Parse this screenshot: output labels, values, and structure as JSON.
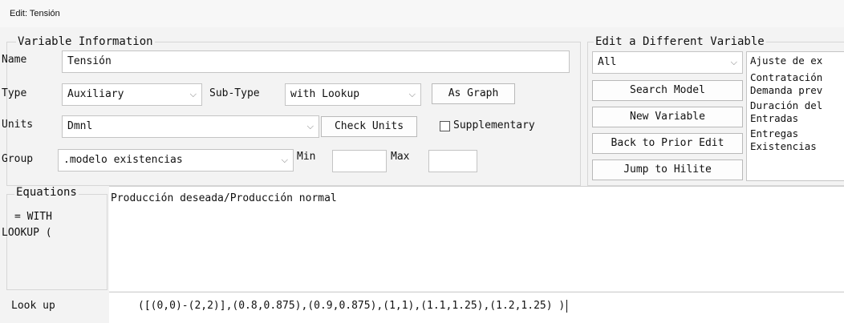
{
  "window": {
    "title": "Edit: Tensión"
  },
  "variable_info": {
    "legend": "Variable Information",
    "name_label": "Name",
    "name_value": "Tensión",
    "type_label": "Type",
    "type_value": "Auxiliary",
    "subtype_label": "Sub-Type",
    "subtype_value": "with Lookup",
    "as_graph_label": "As Graph",
    "units_label": "Units",
    "units_value": "Dmnl",
    "check_units_label": "Check Units",
    "supplementary_label": "Supplementary",
    "supplementary_checked": false,
    "group_label": "Group",
    "group_value": ".modelo existencias",
    "min_label": "Min",
    "min_value": "",
    "max_label": "Max",
    "max_value": ""
  },
  "edit_different": {
    "legend": "Edit a Different Variable",
    "filter_value": "All",
    "buttons": [
      "Search Model",
      "New Variable",
      "Back to Prior Edit",
      "Jump to Hilite"
    ],
    "variables": [
      "Ajuste de ex",
      "Contratación",
      "Demanda prev",
      "Duración del",
      "Entradas",
      "Entregas",
      "Existencias"
    ]
  },
  "equations": {
    "legend": "Equations",
    "prefix_line1": "= WITH",
    "prefix_line2": "LOOKUP (",
    "text": "Producción deseada/Producción normal"
  },
  "lookup": {
    "label": "Look up",
    "text": "([(0,0)-(2,2)],(0.8,0.875),(0.9,0.875),(1,1),(1.1,1.25),(1.2,1.25) )"
  },
  "colors": {
    "background": "#f3f3f3",
    "field": "#ffffff",
    "border": "#c4c4c4"
  },
  "icons": {
    "dropdown": "chevron-down-icon"
  }
}
